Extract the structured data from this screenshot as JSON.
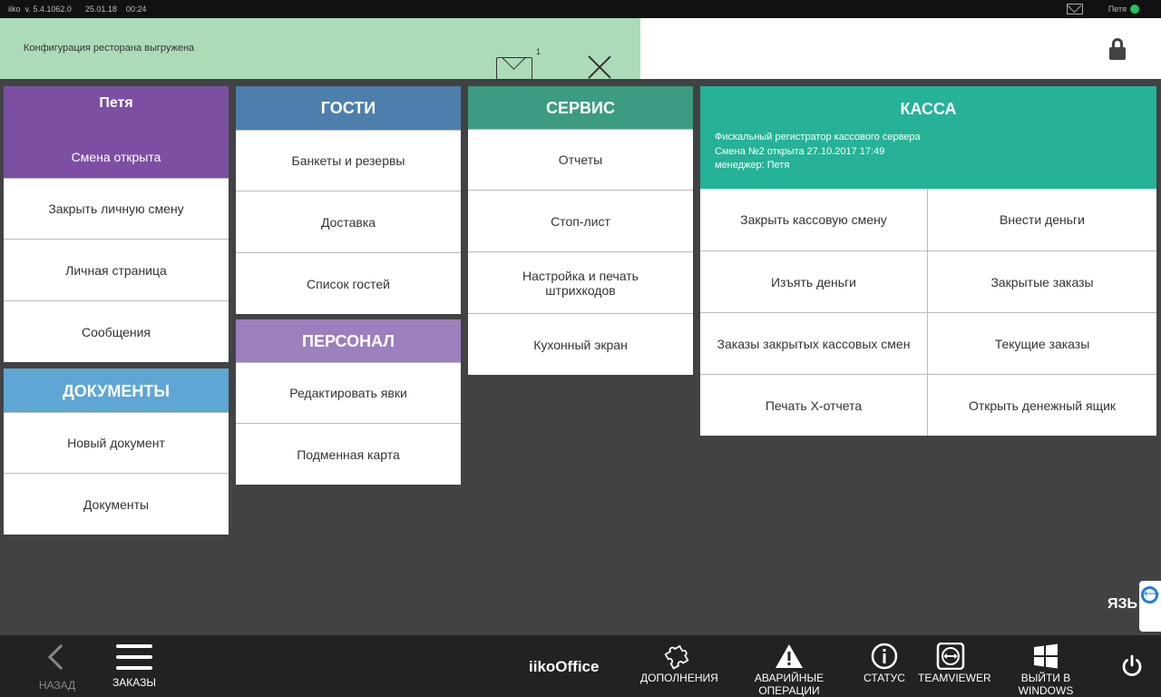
{
  "sysbar": {
    "version": "iiko  v. 5.4.1062.0      25.01.18    00:24",
    "user": "Петя",
    "status_color": "#22c55e"
  },
  "notification": {
    "message": "Конфигурация ресторана выгружена",
    "count": "1"
  },
  "user_panel": {
    "name": "Петя",
    "shift_state": "Смена открыта",
    "items": [
      "Закрыть личную смену",
      "Личная страница",
      "Сообщения"
    ]
  },
  "documents": {
    "title": "ДОКУМЕНТЫ",
    "items": [
      "Новый документ",
      "Документы"
    ]
  },
  "guests": {
    "title": "ГОСТИ",
    "items": [
      "Банкеты и резервы",
      "Доставка",
      "Список гостей"
    ]
  },
  "staff": {
    "title": "ПЕРСОНАЛ",
    "items": [
      "Редактировать явки",
      "Подменная карта"
    ]
  },
  "service": {
    "title": "СЕРВИС",
    "items": [
      "Отчеты",
      "Стоп-лист",
      "Настройка и печать штрихкодов",
      "Кухонный экран"
    ]
  },
  "cash": {
    "title": "КАССА",
    "info": [
      "Фискальный регистратор кассового сервера",
      "Смена №2 открыта 27.10.2017 17:49",
      "менеджер: Петя"
    ],
    "items": [
      "Закрыть кассовую смену",
      "Внести деньги",
      "Изъять деньги",
      "Закрытые заказы",
      "Заказы закрытых кассовых смен",
      "Текущие заказы",
      "Печать Х-отчета",
      "Открыть денежный ящик"
    ]
  },
  "side": {
    "lang": "ЯЗЬ"
  },
  "bottom": {
    "back": "НАЗАД",
    "orders": "ЗАКАЗЫ",
    "brand": "iikoOffice",
    "addons": "ДОПОЛНЕНИЯ",
    "emergency": "АВАРИЙНЫЕ ОПЕРАЦИИ",
    "status": "СТАТУС",
    "teamviewer": "TEAMVIEWER",
    "exit_windows": "ВЫЙТИ В WINDOWS"
  }
}
